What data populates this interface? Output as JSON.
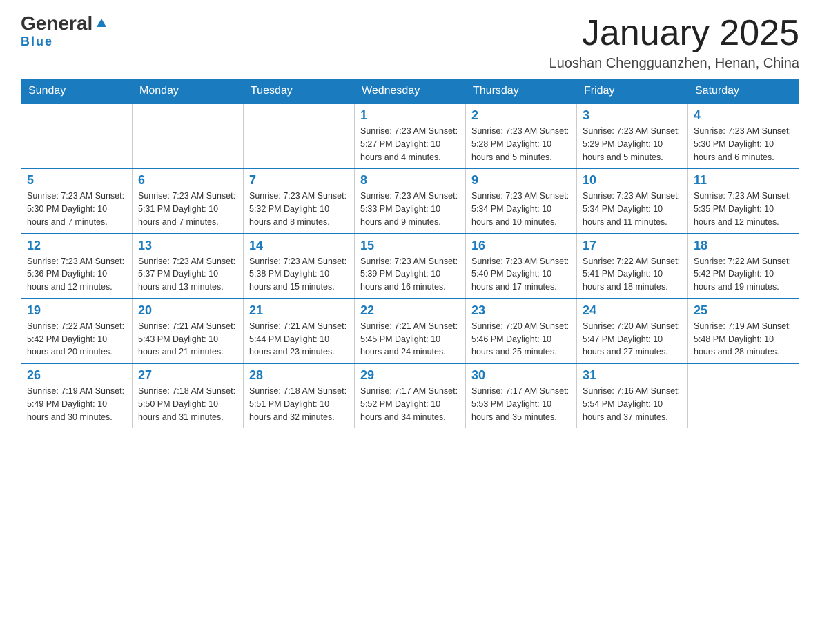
{
  "logo": {
    "name1": "General",
    "name2": "Blue"
  },
  "title": "January 2025",
  "subtitle": "Luoshan Chengguanzhen, Henan, China",
  "days_of_week": [
    "Sunday",
    "Monday",
    "Tuesday",
    "Wednesday",
    "Thursday",
    "Friday",
    "Saturday"
  ],
  "weeks": [
    [
      {
        "day": "",
        "info": ""
      },
      {
        "day": "",
        "info": ""
      },
      {
        "day": "",
        "info": ""
      },
      {
        "day": "1",
        "info": "Sunrise: 7:23 AM\nSunset: 5:27 PM\nDaylight: 10 hours and 4 minutes."
      },
      {
        "day": "2",
        "info": "Sunrise: 7:23 AM\nSunset: 5:28 PM\nDaylight: 10 hours and 5 minutes."
      },
      {
        "day": "3",
        "info": "Sunrise: 7:23 AM\nSunset: 5:29 PM\nDaylight: 10 hours and 5 minutes."
      },
      {
        "day": "4",
        "info": "Sunrise: 7:23 AM\nSunset: 5:30 PM\nDaylight: 10 hours and 6 minutes."
      }
    ],
    [
      {
        "day": "5",
        "info": "Sunrise: 7:23 AM\nSunset: 5:30 PM\nDaylight: 10 hours and 7 minutes."
      },
      {
        "day": "6",
        "info": "Sunrise: 7:23 AM\nSunset: 5:31 PM\nDaylight: 10 hours and 7 minutes."
      },
      {
        "day": "7",
        "info": "Sunrise: 7:23 AM\nSunset: 5:32 PM\nDaylight: 10 hours and 8 minutes."
      },
      {
        "day": "8",
        "info": "Sunrise: 7:23 AM\nSunset: 5:33 PM\nDaylight: 10 hours and 9 minutes."
      },
      {
        "day": "9",
        "info": "Sunrise: 7:23 AM\nSunset: 5:34 PM\nDaylight: 10 hours and 10 minutes."
      },
      {
        "day": "10",
        "info": "Sunrise: 7:23 AM\nSunset: 5:34 PM\nDaylight: 10 hours and 11 minutes."
      },
      {
        "day": "11",
        "info": "Sunrise: 7:23 AM\nSunset: 5:35 PM\nDaylight: 10 hours and 12 minutes."
      }
    ],
    [
      {
        "day": "12",
        "info": "Sunrise: 7:23 AM\nSunset: 5:36 PM\nDaylight: 10 hours and 12 minutes."
      },
      {
        "day": "13",
        "info": "Sunrise: 7:23 AM\nSunset: 5:37 PM\nDaylight: 10 hours and 13 minutes."
      },
      {
        "day": "14",
        "info": "Sunrise: 7:23 AM\nSunset: 5:38 PM\nDaylight: 10 hours and 15 minutes."
      },
      {
        "day": "15",
        "info": "Sunrise: 7:23 AM\nSunset: 5:39 PM\nDaylight: 10 hours and 16 minutes."
      },
      {
        "day": "16",
        "info": "Sunrise: 7:23 AM\nSunset: 5:40 PM\nDaylight: 10 hours and 17 minutes."
      },
      {
        "day": "17",
        "info": "Sunrise: 7:22 AM\nSunset: 5:41 PM\nDaylight: 10 hours and 18 minutes."
      },
      {
        "day": "18",
        "info": "Sunrise: 7:22 AM\nSunset: 5:42 PM\nDaylight: 10 hours and 19 minutes."
      }
    ],
    [
      {
        "day": "19",
        "info": "Sunrise: 7:22 AM\nSunset: 5:42 PM\nDaylight: 10 hours and 20 minutes."
      },
      {
        "day": "20",
        "info": "Sunrise: 7:21 AM\nSunset: 5:43 PM\nDaylight: 10 hours and 21 minutes."
      },
      {
        "day": "21",
        "info": "Sunrise: 7:21 AM\nSunset: 5:44 PM\nDaylight: 10 hours and 23 minutes."
      },
      {
        "day": "22",
        "info": "Sunrise: 7:21 AM\nSunset: 5:45 PM\nDaylight: 10 hours and 24 minutes."
      },
      {
        "day": "23",
        "info": "Sunrise: 7:20 AM\nSunset: 5:46 PM\nDaylight: 10 hours and 25 minutes."
      },
      {
        "day": "24",
        "info": "Sunrise: 7:20 AM\nSunset: 5:47 PM\nDaylight: 10 hours and 27 minutes."
      },
      {
        "day": "25",
        "info": "Sunrise: 7:19 AM\nSunset: 5:48 PM\nDaylight: 10 hours and 28 minutes."
      }
    ],
    [
      {
        "day": "26",
        "info": "Sunrise: 7:19 AM\nSunset: 5:49 PM\nDaylight: 10 hours and 30 minutes."
      },
      {
        "day": "27",
        "info": "Sunrise: 7:18 AM\nSunset: 5:50 PM\nDaylight: 10 hours and 31 minutes."
      },
      {
        "day": "28",
        "info": "Sunrise: 7:18 AM\nSunset: 5:51 PM\nDaylight: 10 hours and 32 minutes."
      },
      {
        "day": "29",
        "info": "Sunrise: 7:17 AM\nSunset: 5:52 PM\nDaylight: 10 hours and 34 minutes."
      },
      {
        "day": "30",
        "info": "Sunrise: 7:17 AM\nSunset: 5:53 PM\nDaylight: 10 hours and 35 minutes."
      },
      {
        "day": "31",
        "info": "Sunrise: 7:16 AM\nSunset: 5:54 PM\nDaylight: 10 hours and 37 minutes."
      },
      {
        "day": "",
        "info": ""
      }
    ]
  ]
}
